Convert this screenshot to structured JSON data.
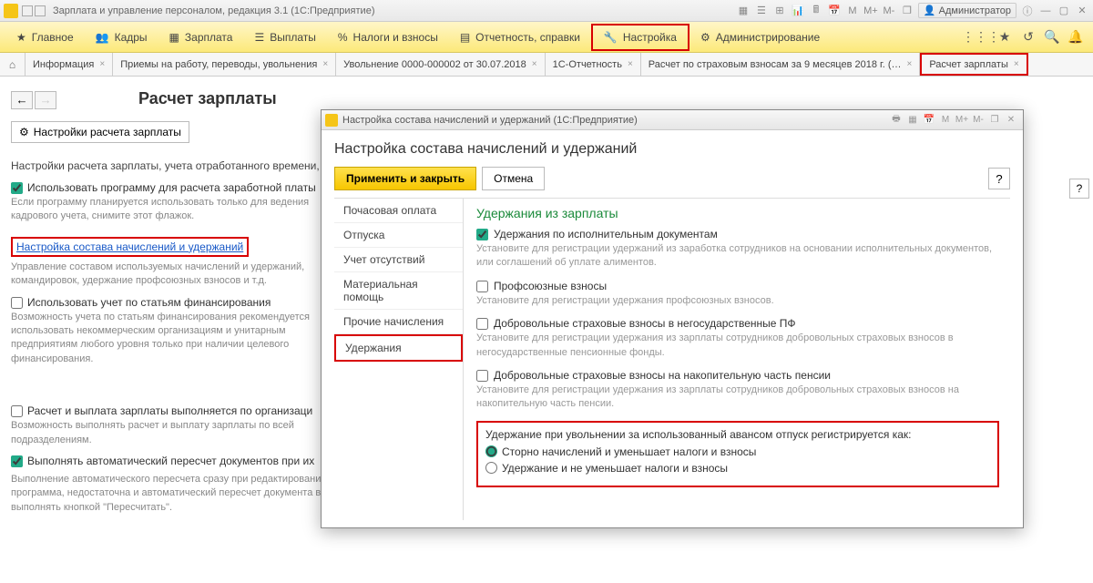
{
  "titlebar": {
    "app_title": "Зарплата и управление персоналом, редакция 3.1 (1С:Предприятие)",
    "user": "Администратор",
    "mem": [
      "M",
      "M+",
      "M-"
    ]
  },
  "menu": {
    "items": [
      {
        "label": "Главное"
      },
      {
        "label": "Кадры"
      },
      {
        "label": "Зарплата"
      },
      {
        "label": "Выплаты"
      },
      {
        "label": "Налоги и взносы"
      },
      {
        "label": "Отчетность, справки"
      },
      {
        "label": "Настройка"
      },
      {
        "label": "Администрирование"
      }
    ]
  },
  "tabs": {
    "items": [
      {
        "label": "Информация"
      },
      {
        "label": "Приемы на работу, переводы, увольнения"
      },
      {
        "label": "Увольнение 0000-000002 от 30.07.2018"
      },
      {
        "label": "1С-Отчетность"
      },
      {
        "label": "Расчет по страховым взносам за 9 месяцев 2018 г. (…"
      },
      {
        "label": "Расчет зарплаты"
      }
    ]
  },
  "page": {
    "title": "Расчет зарплаты",
    "tool_btn": "Настройки расчета зарплаты",
    "text1": "Настройки расчета зарплаты, учета отработанного времени,",
    "chk1": "Использовать программу для расчета заработной платы",
    "note1": "Если программу планируется использовать только для веде­ния кадрового учета, снимите этот флажок.",
    "link1": "Настройка состава начислений и удержаний",
    "note2": "Управление составом используемых начислений и удержан­ий, командировок, удержание профсоюзных взносов и т.д.",
    "chk2": "Использовать учет по статьям финансирования",
    "note3": "Возможность учета по статьям финансирования рекомендуется использовать некоммерческим организациям и унитарным предприятиям любого уровня только при наличии целевого финансирования.",
    "chk3": "Расчет и выплата зарплаты выполняется по организаци",
    "note4": "Возможность выполнять расчет и выплату зарплаты по всей подразделениям.",
    "chk4": "Выполнять автоматический пересчет документов при их",
    "note5": "Выполнение автоматического пересчета сразу при редактировании документа. Если производительность вашего компьютера или сервера, на котором установлена программа, недостаточна и автоматический пересчет документа выполняется с большими задержками, не используйте эту возможность. Пересчет документов можно будет выполнять кнопкой \"Пересчитать\"."
  },
  "dialog": {
    "title": "Настройка состава начислений и удержаний  (1С:Предприятие)",
    "heading": "Настройка состава начислений и удержаний",
    "btn_apply": "Применить и закрыть",
    "btn_cancel": "Отмена",
    "side": [
      "Почасовая оплата",
      "Отпуска",
      "Учет отсутствий",
      "Материальная помощь",
      "Прочие начисления",
      "Удержания"
    ],
    "section": "Удержания из зарплаты",
    "opt1": "Удержания по исполнительным документам",
    "opt1_note": "Установите для регистрации удержаний из заработка сотрудников на основании исполнительных документов, или соглашений об уплате алиментов.",
    "opt2": "Профсоюзные взносы",
    "opt2_note": "Установите для регистрации удержания профсоюзных взносов.",
    "opt3": "Добровольные страховые взносы в негосударственные ПФ",
    "opt3_note": "Установите для регистрации удержания из зарплаты сотрудников добровольных страховых взносов в негосударственные пенсионные фонды.",
    "opt4": "Добровольные страховые взносы на накопительную часть пенсии",
    "opt4_note": "Установите для регистрации удержания из зарплаты сотрудников добровольных страховых взносов на накопительную часть пенсии.",
    "radio_title": "Удержание при увольнении за использованный авансом отпуск регистрируется как:",
    "radio1": "Сторно начислений и уменьшает налоги и взносы",
    "radio2": "Удержание и не уменьшает налоги и взносы"
  }
}
